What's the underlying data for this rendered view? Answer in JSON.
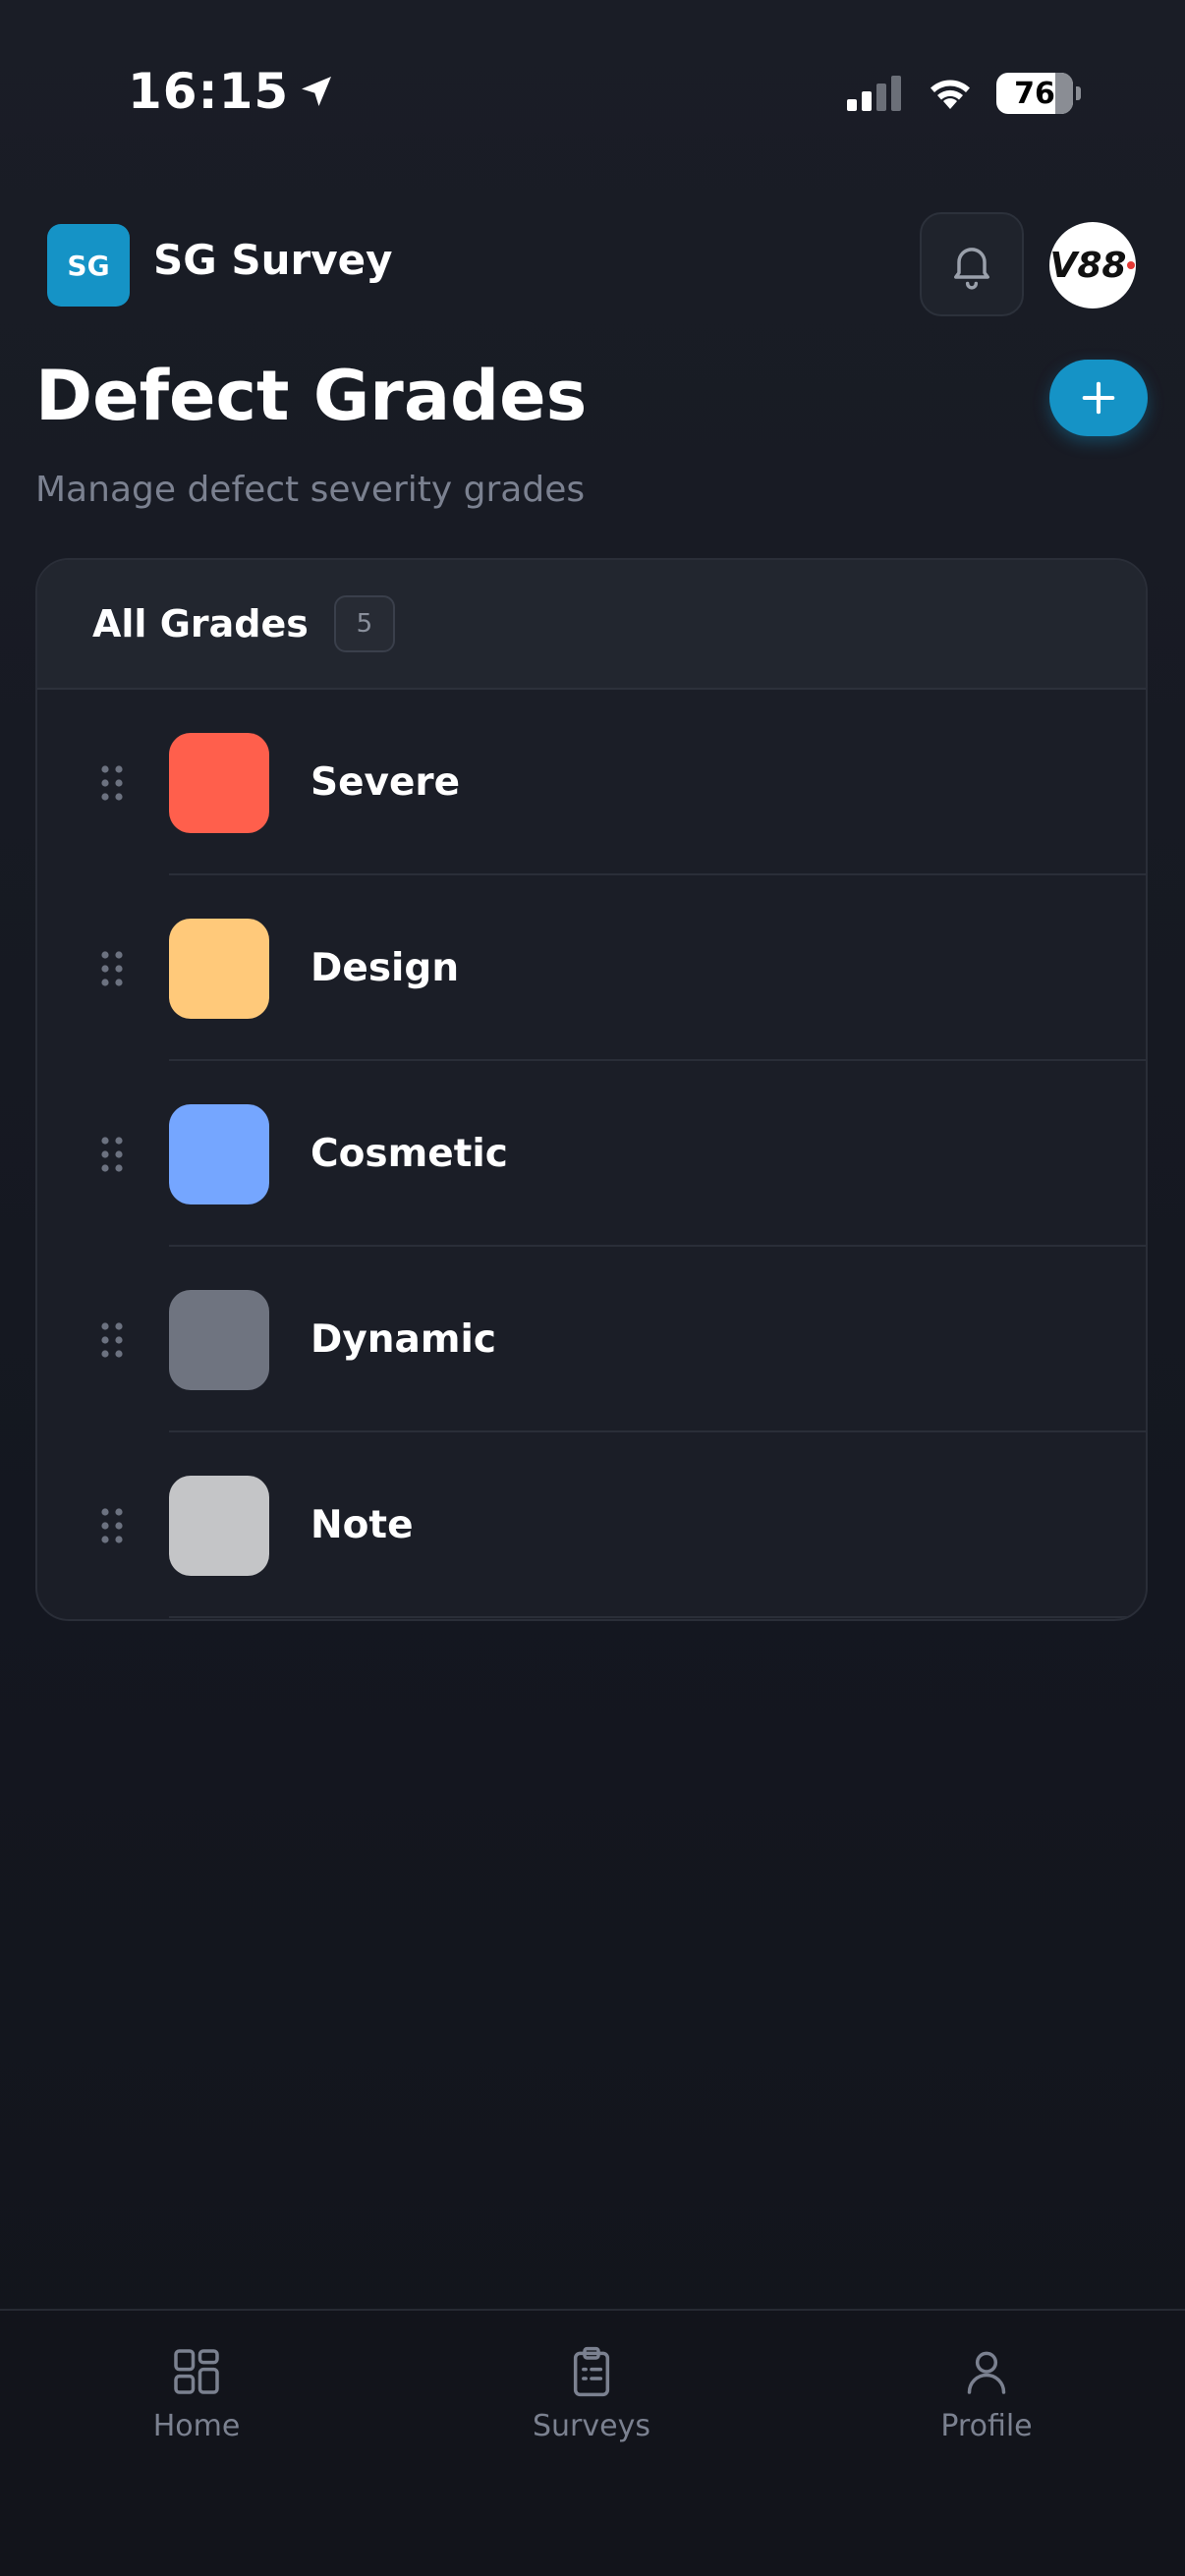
{
  "status_bar": {
    "time": "16:15",
    "battery": "76",
    "location_icon": "location-arrow-icon",
    "signal_icon": "cellular-signal-icon",
    "wifi_icon": "wifi-icon"
  },
  "header": {
    "logo_text": "SG",
    "app_name": "SG Survey",
    "bell_icon": "bell-icon",
    "avatar_text": "V88"
  },
  "page": {
    "title": "Defect Grades",
    "subtitle": "Manage defect severity grades",
    "add_icon": "plus-icon"
  },
  "card": {
    "title": "All Grades",
    "count": "5",
    "grades": [
      {
        "name": "Severe",
        "color": "#ff5f4c"
      },
      {
        "name": "Design",
        "color": "#ffc97a"
      },
      {
        "name": "Cosmetic",
        "color": "#75a6ff"
      },
      {
        "name": "Dynamic",
        "color": "#6f7480"
      },
      {
        "name": "Note",
        "color": "#c4c5c7"
      }
    ]
  },
  "tabs": [
    {
      "label": "Home",
      "icon": "grid-icon"
    },
    {
      "label": "Surveys",
      "icon": "clipboard-icon"
    },
    {
      "label": "Profile",
      "icon": "user-icon"
    }
  ],
  "colors": {
    "accent": "#1593c6",
    "background": "#151821",
    "card": "#1b1e27"
  }
}
